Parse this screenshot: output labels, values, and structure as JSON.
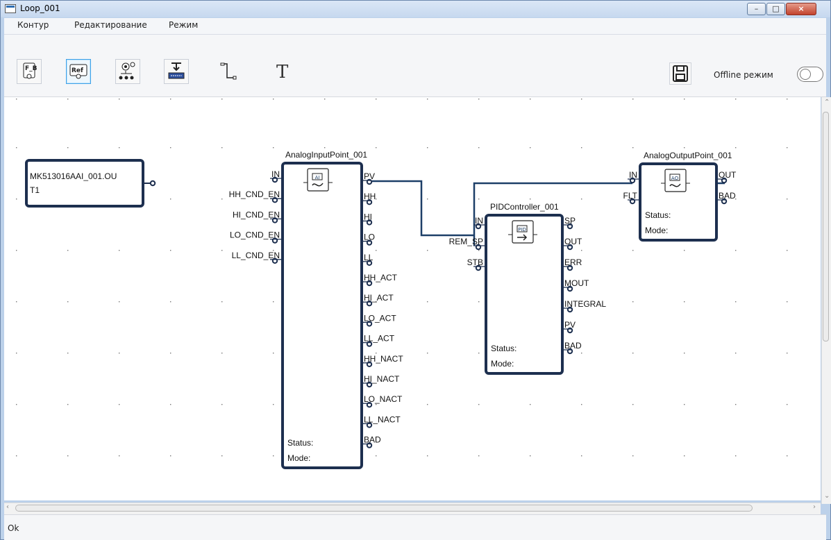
{
  "window": {
    "title": "Loop_001",
    "controls": [
      "–",
      "□",
      "×"
    ]
  },
  "menu": {
    "items": [
      "Контур",
      "Редактирование",
      "Режим"
    ]
  },
  "toolbar": {
    "tools": [
      "F_B",
      "Ref",
      "gear",
      "download",
      "line",
      "T"
    ],
    "offline_label": "Offline режим"
  },
  "diagram": {
    "reference_block": {
      "line1": "MK513016AAI_001.OU",
      "line2": "T1"
    },
    "analog_input": {
      "name": "AnalogInputPoint_001",
      "icon_label": "AI",
      "inputs": [
        "IN",
        "HH_CND_EN",
        "HI_CND_EN",
        "LO_CND_EN",
        "LL_CND_EN"
      ],
      "outputs": [
        "PV",
        "HH",
        "HI",
        "LO",
        "LL",
        "HH_ACT",
        "HI_ACT",
        "LO_ACT",
        "LL_ACT",
        "HH_NACT",
        "HI_NACT",
        "LO_NACT",
        "LL_NACT",
        "BAD"
      ],
      "status_label": "Status:",
      "mode_label": "Mode:"
    },
    "pid": {
      "name": "PIDController_001",
      "icon_label": "PID",
      "inputs": [
        "IN",
        "REM_SP",
        "STB"
      ],
      "outputs": [
        "SP",
        "OUT",
        "ERR",
        "MOUT",
        "INTEGRAL",
        "PV",
        "BAD"
      ],
      "status_label": "Status:",
      "mode_label": "Mode:"
    },
    "analog_output": {
      "name": "AnalogOutputPoint_001",
      "icon_label": "AO",
      "inputs": [
        "IN",
        "FLT"
      ],
      "outputs": [
        "OUT",
        "BAD"
      ],
      "status_label": "Status:",
      "mode_label": "Mode:"
    }
  },
  "status_bar": {
    "text": "Ok"
  },
  "colors": {
    "block_border": "#1d2f4f",
    "connection": "#1d3f68",
    "titlebar": "#c6d8ef",
    "accent": "#3fa2e8"
  }
}
